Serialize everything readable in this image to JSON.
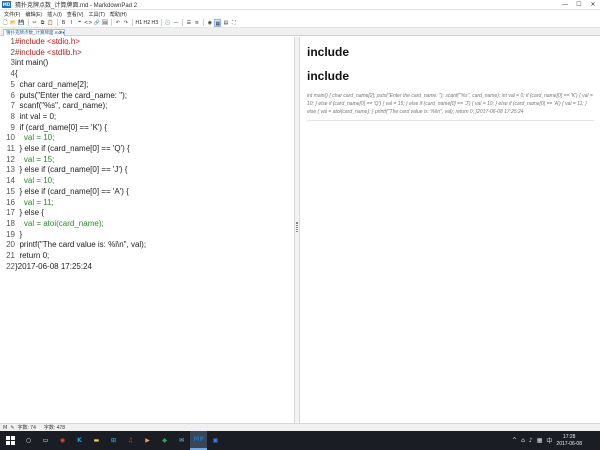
{
  "window": {
    "title": "猜扑克牌点数_计算牌面.md - MarkdownPad 2",
    "app_icon_text": "MD",
    "controls": [
      "—",
      "☐",
      "✕"
    ]
  },
  "menu": [
    {
      "label": "文件(F)"
    },
    {
      "label": "编辑(E)"
    },
    {
      "label": "插入(I)"
    },
    {
      "label": "查看(V)"
    },
    {
      "label": "工具(T)"
    },
    {
      "label": "帮助(H)"
    }
  ],
  "toolbar": [
    {
      "name": "new-file",
      "glyph": "🗋"
    },
    {
      "name": "open-file",
      "glyph": "📂"
    },
    {
      "name": "save-file",
      "glyph": "💾"
    },
    {
      "sep": true
    },
    {
      "name": "cut",
      "glyph": "✂"
    },
    {
      "name": "copy",
      "glyph": "⧉"
    },
    {
      "name": "paste",
      "glyph": "📋"
    },
    {
      "sep": true
    },
    {
      "name": "bold",
      "glyph": "B"
    },
    {
      "name": "italic",
      "glyph": "I"
    },
    {
      "name": "quote",
      "glyph": "❝"
    },
    {
      "name": "code",
      "glyph": "<>"
    },
    {
      "name": "hyperlink",
      "glyph": "🔗"
    },
    {
      "name": "image",
      "glyph": "🖼"
    },
    {
      "sep": true
    },
    {
      "name": "undo",
      "glyph": "↶"
    },
    {
      "name": "redo",
      "glyph": "↷"
    },
    {
      "sep": true
    },
    {
      "name": "heading-1",
      "glyph": "H1"
    },
    {
      "name": "heading-2",
      "glyph": "H2"
    },
    {
      "name": "heading-3",
      "glyph": "H3"
    },
    {
      "sep": true
    },
    {
      "name": "timestamp",
      "glyph": "🕒"
    },
    {
      "name": "horizontal-rule",
      "glyph": "—"
    },
    {
      "sep": true
    },
    {
      "name": "unordered-list",
      "glyph": "☰"
    },
    {
      "name": "ordered-list",
      "glyph": "≡"
    },
    {
      "sep": true
    },
    {
      "name": "preview-browser",
      "glyph": "◉"
    },
    {
      "name": "toggle-preview",
      "glyph": "▦",
      "pressed": true
    },
    {
      "name": "preview-only",
      "glyph": "▤"
    },
    {
      "name": "fullscreen",
      "glyph": "⛶"
    }
  ],
  "tab": {
    "label": "猜扑克牌点数_计算牌面.md",
    "modified_marker": "●",
    "close": "✕"
  },
  "editor": {
    "lines": [
      {
        "no": "1",
        "text": "#include <stdio.h>",
        "style": "red"
      },
      {
        "no": "2",
        "text": "#include <stdlib.h>",
        "style": "red"
      },
      {
        "no": "3",
        "text": "int main()",
        "style": ""
      },
      {
        "no": "4",
        "text": "{",
        "style": ""
      },
      {
        "no": "5",
        "text": "  char card_name[2];",
        "style": ""
      },
      {
        "no": "6",
        "text": "  puts(\"Enter the card_name: \");",
        "style": ""
      },
      {
        "no": "7",
        "text": "  scanf(\"%s\", card_name);",
        "style": ""
      },
      {
        "no": "8",
        "text": "  int val = 0;",
        "style": ""
      },
      {
        "no": "9",
        "text": "  if (card_name[0] == 'K') {",
        "style": ""
      },
      {
        "no": "10",
        "text": "    val = 10;",
        "style": "green"
      },
      {
        "no": "11",
        "text": "  } else if (card_name[0] == 'Q') {",
        "style": ""
      },
      {
        "no": "12",
        "text": "    val = 15;",
        "style": "green"
      },
      {
        "no": "13",
        "text": "  } else if (card_name[0] == 'J') {",
        "style": ""
      },
      {
        "no": "14",
        "text": "    val = 10;",
        "style": "green"
      },
      {
        "no": "15",
        "text": "  } else if (card_name[0] == 'A') {",
        "style": ""
      },
      {
        "no": "16",
        "text": "    val = 11;",
        "style": "green"
      },
      {
        "no": "17",
        "text": "  } else {",
        "style": ""
      },
      {
        "no": "18",
        "text": "    val = atoi(card_name);",
        "style": "green"
      },
      {
        "no": "19",
        "text": "  }",
        "style": ""
      },
      {
        "no": "20",
        "text": "  printf(\"The card value is: %i\\n\", val);",
        "style": ""
      },
      {
        "no": "21",
        "text": "  return 0;",
        "style": ""
      },
      {
        "no": "22",
        "text": "}2017-06-08 17:25:24",
        "style": ""
      }
    ]
  },
  "preview": {
    "heading_1": "include",
    "heading_2": "include",
    "paragraph": "int main() { char card_name[2]; puts(\"Enter the card_name: \"); scanf(\"%s\", card_name); int val = 0; if (card_name[0] == 'K') { val = 10; } else if (card_name[0] == 'Q') { val = 15; } else if (card_name[0] == 'J') { val = 10; } else if (card_name[0] == 'A') { val = 11; } else { val = atoi(card_name); } printf(\"The card value is: %i\\n\", val); return 0; }2017-06-08 17:25:24"
  },
  "status": {
    "icon_markdown": "M",
    "icon_edit": "✎",
    "words": "字数: 74",
    "chars": "字数: 478"
  },
  "taskbar": {
    "apps": [
      {
        "name": "search",
        "glyph": "○",
        "color": "#ffffff"
      },
      {
        "name": "task-view",
        "glyph": "▭",
        "color": "#ffffff"
      },
      {
        "name": "chrome",
        "glyph": "◉",
        "color": "#e8453c"
      },
      {
        "name": "visual-studio",
        "glyph": "K",
        "color": "#2d9cdb"
      },
      {
        "name": "file-explorer",
        "glyph": "▬",
        "color": "#f2c94c"
      },
      {
        "name": "store",
        "glyph": "⊞",
        "color": "#2d9cdb"
      },
      {
        "name": "netease-music",
        "glyph": "♫",
        "color": "#d33a31"
      },
      {
        "name": "media-player",
        "glyph": "▶",
        "color": "#f2994a"
      },
      {
        "name": "app-green",
        "glyph": "◆",
        "color": "#27ae60"
      },
      {
        "name": "mail",
        "glyph": "✉",
        "color": "#56ccf2"
      },
      {
        "name": "markdownpad",
        "glyph": "MP",
        "color": "#1e73be",
        "active": true
      },
      {
        "name": "app-blue",
        "glyph": "▣",
        "color": "#2f80ed"
      }
    ],
    "tray": [
      "^",
      "⌂",
      "♪",
      "▦",
      "中"
    ],
    "time": "17:28",
    "date": "2017-06-08"
  }
}
